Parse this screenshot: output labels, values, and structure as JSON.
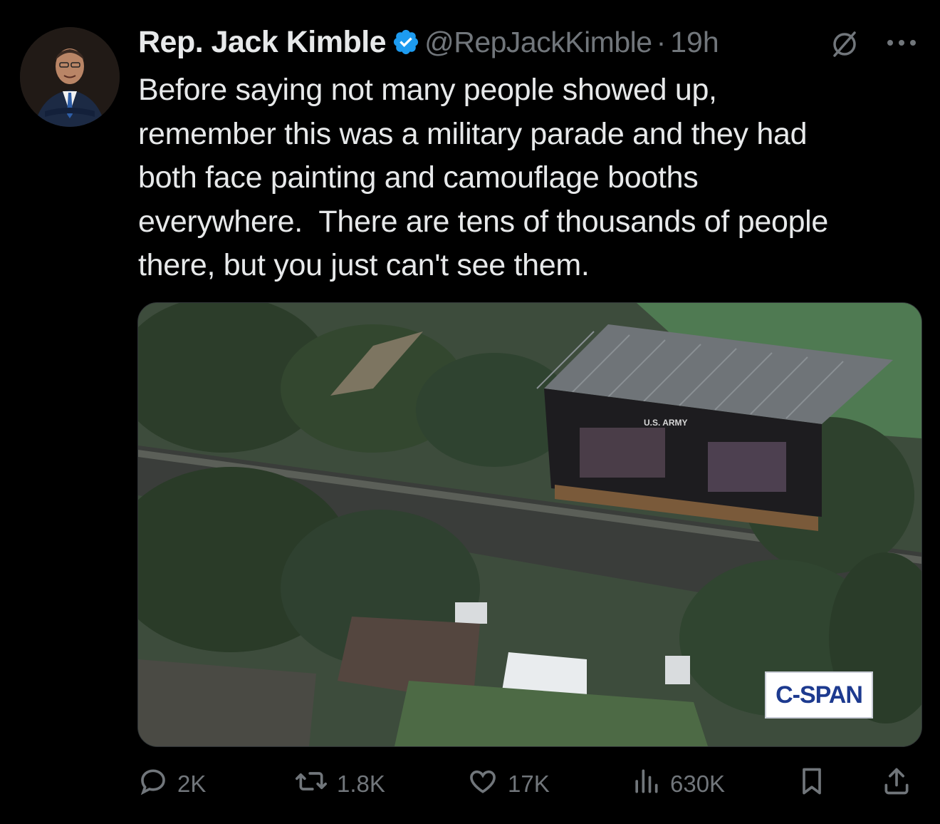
{
  "tweet": {
    "author_name": "Rep. Jack Kimble",
    "handle": "@RepJackKimble",
    "separator": "·",
    "time": "19h",
    "text": "Before saying not many people showed up,\nremember this was a military parade and they had\nboth face painting and camouflage booths\neverywhere.  There are tens of thousands of people\nthere, but you just can't see them.",
    "media": {
      "watermark": "C-SPAN",
      "stage_sign": "U.S. ARMY"
    }
  },
  "actions": {
    "replies": "2K",
    "reposts": "1.8K",
    "likes": "17K",
    "views": "630K"
  },
  "colors": {
    "background": "#000000",
    "text": "#e7e9ea",
    "muted": "#71767b",
    "verified": "#1d9bf0"
  },
  "icons": [
    "verified-badge-icon",
    "grok-icon",
    "more-icon",
    "reply-icon",
    "repost-icon",
    "like-icon",
    "views-icon",
    "bookmark-icon",
    "share-icon"
  ]
}
